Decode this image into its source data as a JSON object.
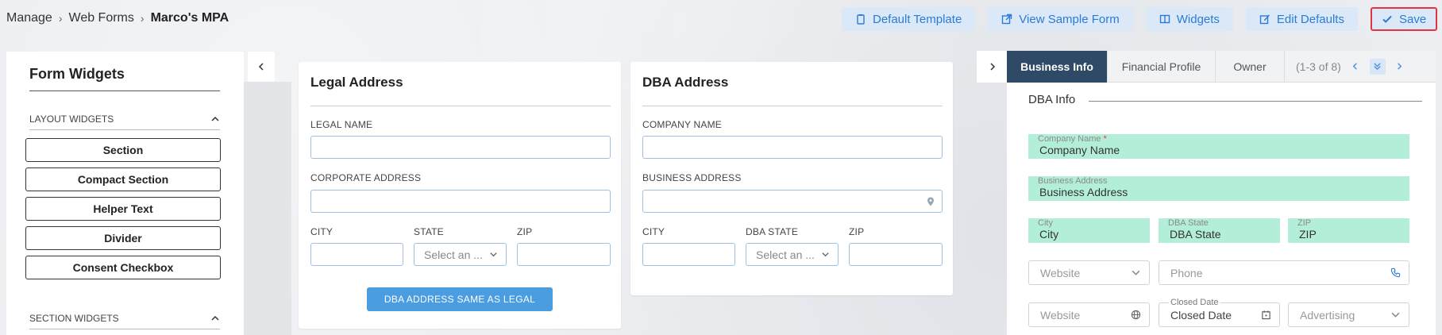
{
  "breadcrumb": {
    "items": [
      "Manage",
      "Web Forms"
    ],
    "current": "Marco's MPA",
    "separator": "›"
  },
  "toolbar": {
    "default_template": "Default Template",
    "view_sample": "View Sample Form",
    "widgets": "Widgets",
    "edit_defaults": "Edit Defaults",
    "save": "Save"
  },
  "left_panel": {
    "title": "Form Widgets",
    "layout_group": "LAYOUT WIDGETS",
    "layout_items": [
      "Section",
      "Compact Section",
      "Helper Text",
      "Divider",
      "Consent Checkbox"
    ],
    "section_group": "SECTION WIDGETS"
  },
  "legal": {
    "heading": "Legal Address",
    "legal_name_label": "LEGAL NAME",
    "corporate_address_label": "CORPORATE ADDRESS",
    "city_label": "CITY",
    "state_label": "STATE",
    "zip_label": "ZIP",
    "state_placeholder": "Select an ...",
    "same_button": "DBA ADDRESS SAME AS LEGAL"
  },
  "dba": {
    "heading": "DBA Address",
    "company_name_label": "COMPANY NAME",
    "business_address_label": "BUSINESS ADDRESS",
    "city_label": "CITY",
    "state_label": "DBA STATE",
    "zip_label": "ZIP",
    "state_placeholder": "Select an ..."
  },
  "right_panel": {
    "tabs": [
      "Business Info",
      "Financial Profile",
      "Owner"
    ],
    "active_tab": "Business Info",
    "pager_text": "(1-3 of 8)",
    "section_title": "DBA Info",
    "fields": {
      "company_name_label": "Company Name",
      "company_name_value": "Company Name",
      "business_address_label": "Business Address",
      "business_address_value": "Business Address",
      "city_label": "City",
      "city_value": "City",
      "dba_state_label": "DBA State",
      "dba_state_value": "DBA State",
      "zip_label": "ZIP",
      "zip_value": "ZIP",
      "website_select": "Website",
      "phone": "Phone",
      "website_input": "Website",
      "closed_date_label": "Closed Date",
      "closed_date_value": "Closed Date",
      "advertising": "Advertising"
    }
  },
  "colors": {
    "accent": "#2a7cd6",
    "save_border": "#e0353f",
    "active_tab": "#2f4a66",
    "green_field": "#b3efd8",
    "primary_button": "#4a9de0"
  }
}
